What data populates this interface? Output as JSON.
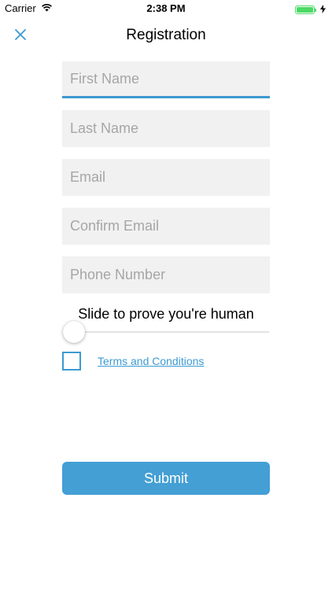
{
  "status_bar": {
    "carrier": "Carrier",
    "time": "2:38 PM",
    "wifi_icon": "wifi-icon",
    "battery_icon": "battery-icon",
    "charging_icon": "charging-bolt-icon",
    "battery_level": 1.0
  },
  "nav": {
    "title": "Registration",
    "close_icon": "close-icon"
  },
  "form": {
    "first_name": {
      "placeholder": "First Name",
      "value": ""
    },
    "last_name": {
      "placeholder": "Last Name",
      "value": ""
    },
    "email": {
      "placeholder": "Email",
      "value": ""
    },
    "confirm_email": {
      "placeholder": "Confirm Email",
      "value": ""
    },
    "phone": {
      "placeholder": "Phone Number",
      "value": ""
    },
    "slider_label": "Slide to prove you're human",
    "slider_value": 0,
    "terms_label": "Terms and Conditions",
    "terms_checked": false,
    "submit_label": "Submit"
  },
  "colors": {
    "accent": "#3d9ad1",
    "submit_bg": "#439fd4",
    "field_bg": "#f1f1f1",
    "placeholder": "#a6a6a6",
    "battery": "#4cd964"
  }
}
